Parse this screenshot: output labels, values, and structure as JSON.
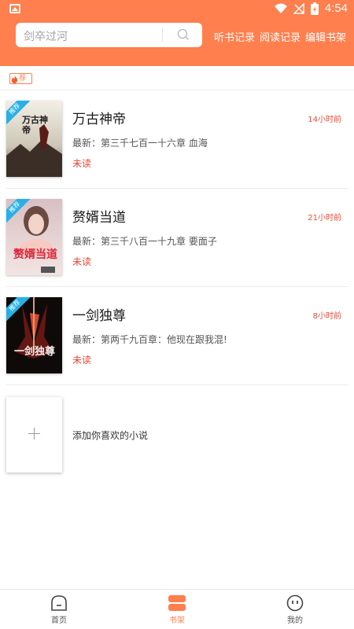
{
  "status_bar": {
    "time": "4:54"
  },
  "header": {
    "search_text": "剑卒过河",
    "links": [
      "听书记录",
      "阅读记录",
      "编辑书架"
    ]
  },
  "tag": {
    "label": "荐"
  },
  "books": [
    {
      "title": "万古神帝",
      "time": "14小时前",
      "latest": "最新：第三千七百一十六章 血海",
      "status": "未读",
      "ribbon": "推荐",
      "cover_text": "万古神帝"
    },
    {
      "title": "赘婿当道",
      "time": "21小时前",
      "latest": "最新：第三千八百一十九章 要面子",
      "status": "未读",
      "ribbon": "推荐",
      "cover_text": "赘婿当道"
    },
    {
      "title": "一剑独尊",
      "time": "8小时前",
      "latest": "最新：第两千九百章：他现在跟我混!",
      "status": "未读",
      "ribbon": "推荐",
      "cover_text": "一剑独尊"
    }
  ],
  "add": {
    "label": "添加你喜欢的小说"
  },
  "tabs": [
    {
      "label": "首页",
      "icon": "home-icon"
    },
    {
      "label": "书架",
      "icon": "bookshelf-icon"
    },
    {
      "label": "我的",
      "icon": "profile-icon"
    }
  ],
  "colors": {
    "accent": "#ff7f4e",
    "unread": "#e8463a",
    "ribbon": "#27b0e6"
  }
}
